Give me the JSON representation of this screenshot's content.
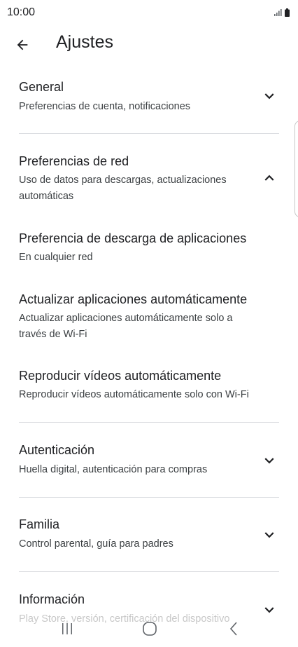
{
  "status_bar": {
    "time": "10:00",
    "icons": [
      "signal-icon",
      "battery-icon"
    ]
  },
  "app_bar": {
    "back_icon": "arrow-back-icon",
    "title": "Ajustes"
  },
  "settings": {
    "general": {
      "title": "General",
      "subtitle": "Preferencias de cuenta, notificaciones",
      "expanded": false
    },
    "network": {
      "title": "Preferencias de red",
      "subtitle": "Uso de datos para descargas, actualizaciones automáticas",
      "expanded": true,
      "items": [
        {
          "title": "Preferencia de descarga de aplicaciones",
          "subtitle": "En cualquier red"
        },
        {
          "title": "Actualizar aplicaciones automáticamente",
          "subtitle": "Actualizar aplicaciones automáticamente solo a través de Wi-Fi"
        },
        {
          "title": "Reproducir vídeos automáticamente",
          "subtitle": "Reproducir vídeos automáticamente solo con Wi-Fi"
        }
      ]
    },
    "authentication": {
      "title": "Autenticación",
      "subtitle": "Huella digital, autenticación para compras",
      "expanded": false
    },
    "family": {
      "title": "Familia",
      "subtitle": "Control parental, guía para padres",
      "expanded": false
    },
    "about": {
      "title": "Información",
      "subtitle": "Play Store, versión, certificación del dispositivo",
      "expanded": false
    }
  },
  "nav_bar": {
    "buttons": [
      "recents-icon",
      "home-icon",
      "back-icon"
    ]
  },
  "colors": {
    "text_primary": "#202124",
    "text_secondary": "#3c4043",
    "divider": "#dadce0",
    "background": "#ffffff"
  }
}
